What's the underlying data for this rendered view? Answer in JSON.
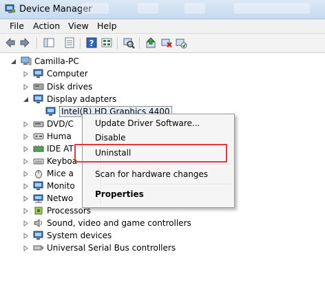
{
  "window": {
    "title": "Device Manager"
  },
  "menubar": {
    "items": [
      "File",
      "Action",
      "View",
      "Help"
    ]
  },
  "toolbar": {
    "buttons": [
      "back-icon",
      "forward-icon",
      "show-hide-console-tree-icon",
      "properties-icon",
      "help-icon",
      "console-view-icon",
      "scan-hardware-icon",
      "update-driver-icon",
      "uninstall-icon",
      "enable-device-icon"
    ]
  },
  "tree": {
    "root": "Camilla-PC",
    "items": [
      {
        "label": "Computer",
        "icon": "computer-icon",
        "expanded": false
      },
      {
        "label": "Disk drives",
        "icon": "disk-drive-icon",
        "expanded": false
      },
      {
        "label": "Display adapters",
        "icon": "display-adapter-icon",
        "expanded": true
      },
      {
        "label": "Intel(R) HD Graphics 4400",
        "icon": "display-adapter-icon",
        "child": true,
        "selected": true
      },
      {
        "label": "DVD/C",
        "icon": "dvd-drive-icon",
        "expanded": false
      },
      {
        "label": "Huma",
        "icon": "hid-icon",
        "expanded": false
      },
      {
        "label": "IDE AT",
        "icon": "ide-controller-icon",
        "expanded": false
      },
      {
        "label": "Keyboa",
        "icon": "keyboard-icon",
        "expanded": false
      },
      {
        "label": "Mice a",
        "icon": "mouse-icon",
        "expanded": false
      },
      {
        "label": "Monito",
        "icon": "monitor-icon",
        "expanded": false
      },
      {
        "label": "Netwo",
        "icon": "network-adapter-icon",
        "expanded": false
      },
      {
        "label": "Processors",
        "icon": "processor-icon",
        "expanded": false
      },
      {
        "label": "Sound, video and game controllers",
        "icon": "sound-icon",
        "expanded": false
      },
      {
        "label": "System devices",
        "icon": "system-device-icon",
        "expanded": false
      },
      {
        "label": "Universal Serial Bus controllers",
        "icon": "usb-icon",
        "expanded": false
      }
    ]
  },
  "context_menu": {
    "items": [
      "Update Driver Software...",
      "Disable",
      "Uninstall",
      "Scan for hardware changes",
      "Properties"
    ],
    "highlighted": "Uninstall",
    "highlight_color": "#e8343c"
  }
}
